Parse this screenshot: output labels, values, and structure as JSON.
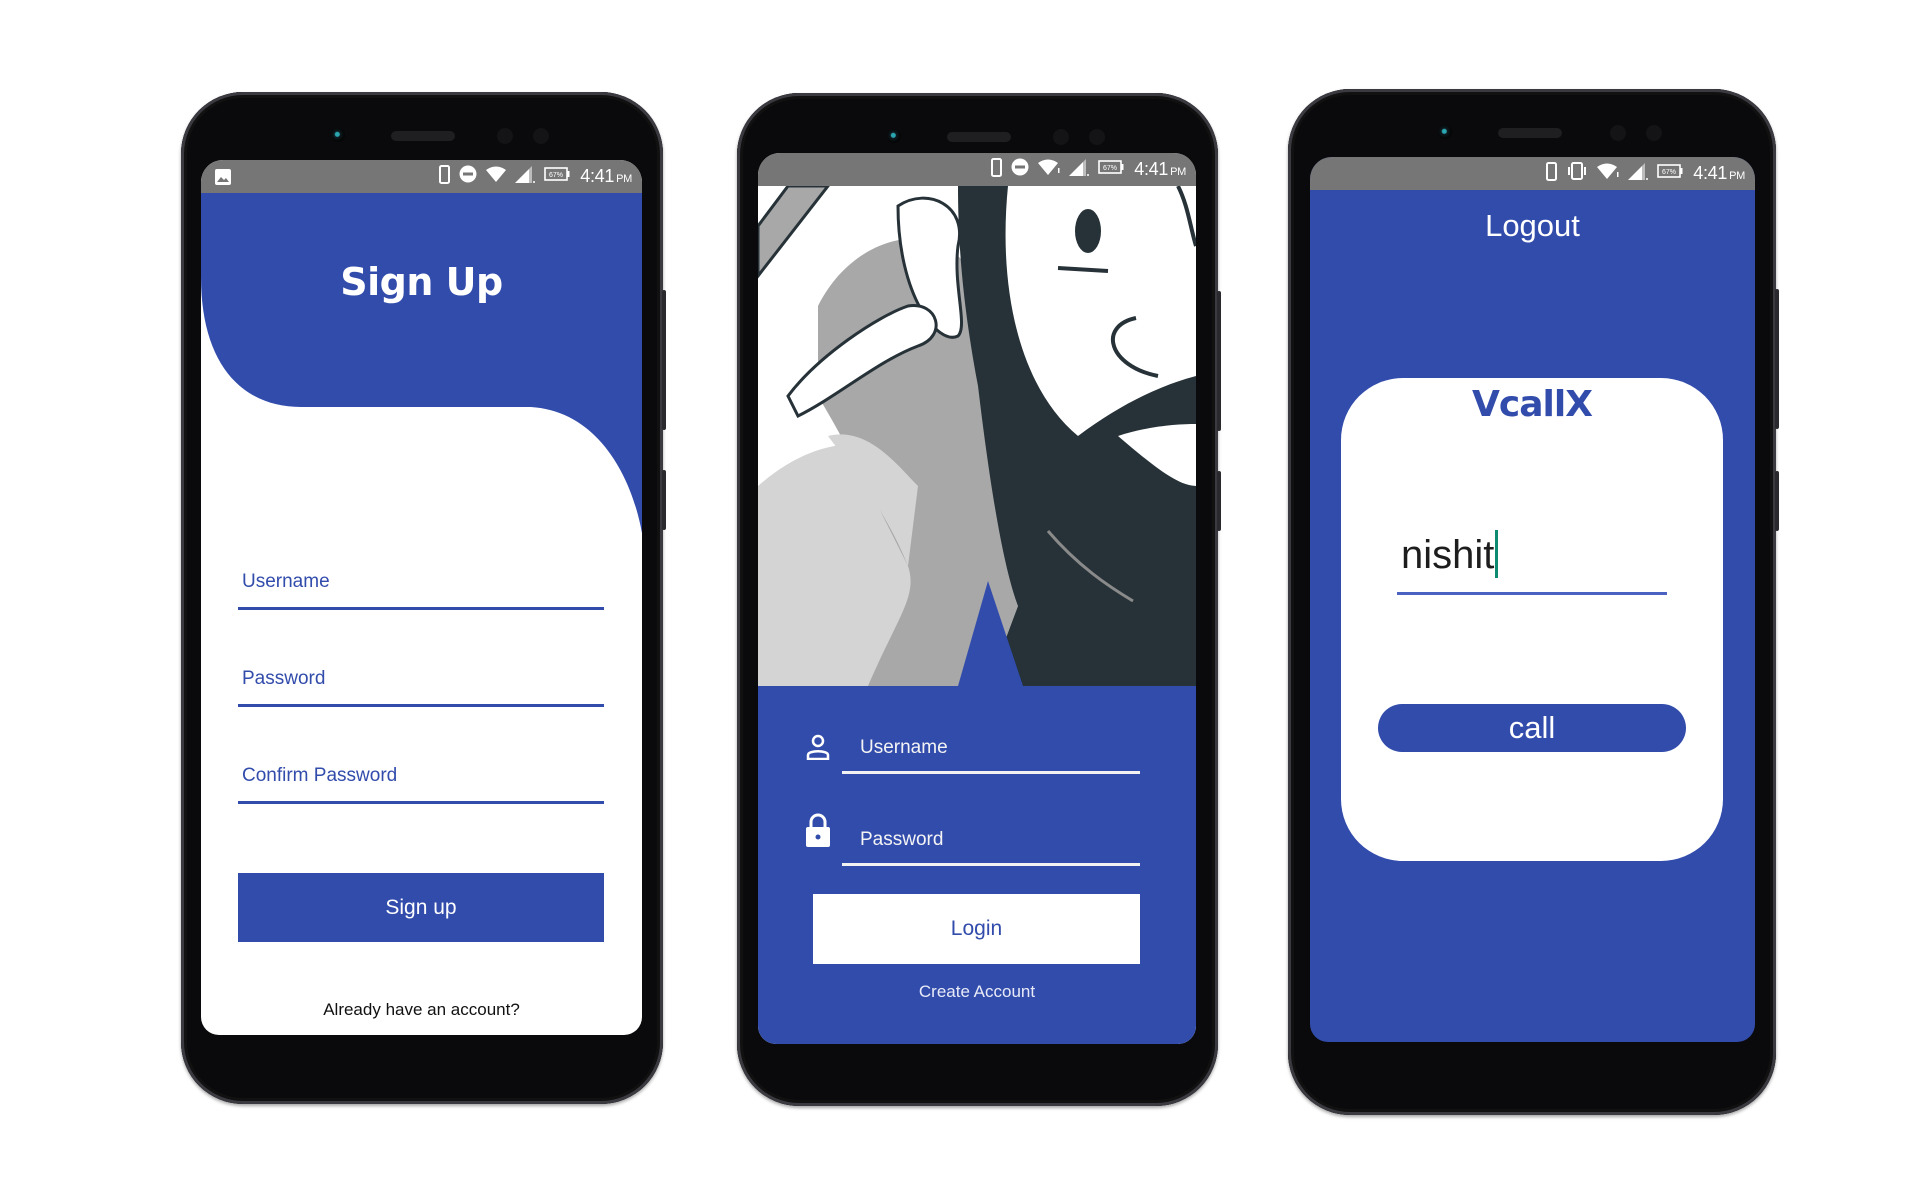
{
  "status_bar": {
    "time": "4:41",
    "ampm": "PM",
    "battery": "67%",
    "icons": [
      "phone-icon",
      "dnd-icon",
      "wifi-icon",
      "signal-icon",
      "battery-icon"
    ],
    "phone3_icons": [
      "phone-icon",
      "vibrate-icon",
      "wifi-icon",
      "signal-icon",
      "battery-icon"
    ],
    "left_icon": "gallery-icon"
  },
  "colors": {
    "brand_blue": "#324cac",
    "status_bar_gray": "#767676",
    "caret_teal": "#0e8a72"
  },
  "signup_screen": {
    "title": "Sign Up",
    "fields": [
      {
        "placeholder": "Username"
      },
      {
        "placeholder": "Password"
      },
      {
        "placeholder": "Confirm Password"
      }
    ],
    "submit_label": "Sign up",
    "footer_link": "Already have an account?"
  },
  "login_screen": {
    "illustration": "bearded-man-thinking-illustration",
    "fields": [
      {
        "placeholder": "Username",
        "icon": "user-icon"
      },
      {
        "placeholder": "Password",
        "icon": "lock-icon"
      }
    ],
    "submit_label": "Login",
    "footer_link": "Create Account"
  },
  "call_screen": {
    "logout_label": "Logout",
    "brand": "VcallX",
    "name_input_value": "nishit",
    "call_label": "call"
  }
}
